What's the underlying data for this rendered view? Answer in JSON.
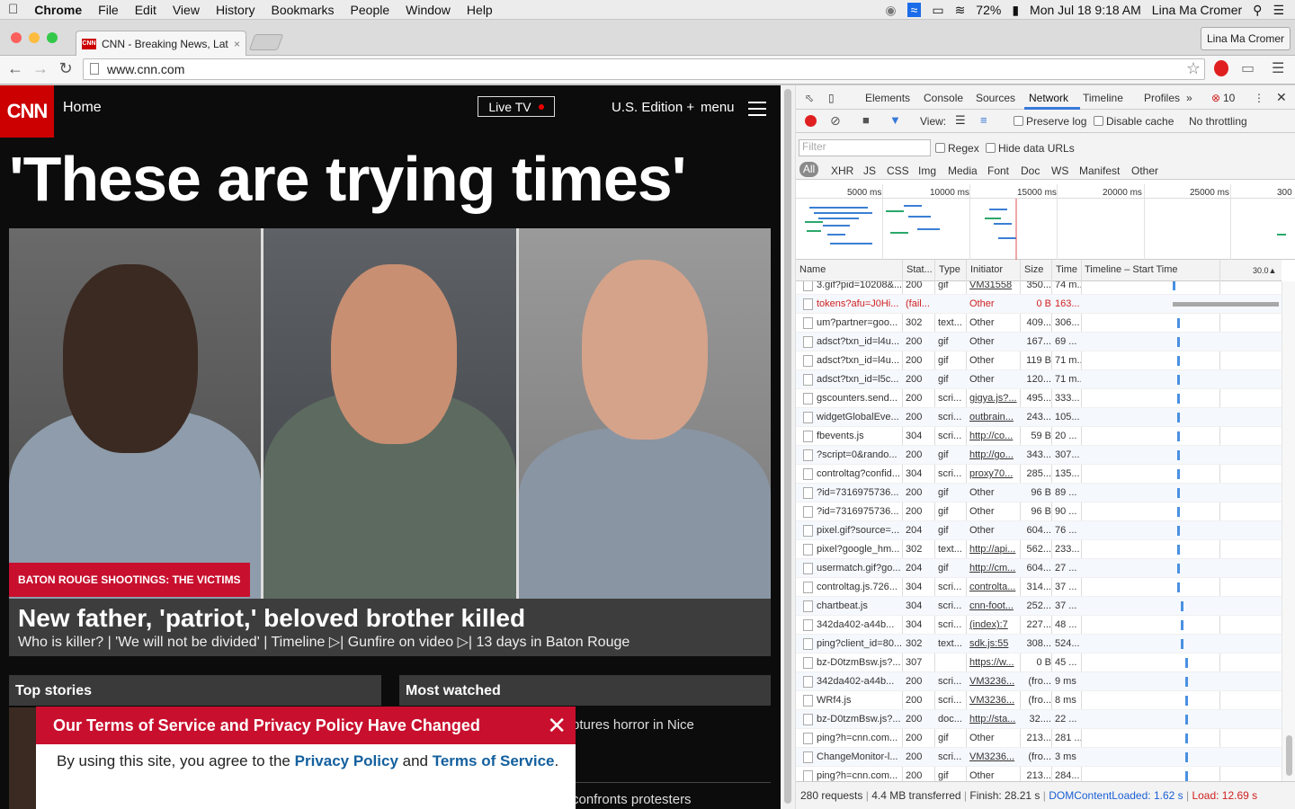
{
  "menubar": {
    "app": "Chrome",
    "items": [
      "File",
      "Edit",
      "View",
      "History",
      "Bookmarks",
      "People",
      "Window",
      "Help"
    ],
    "battery": "72%",
    "datetime": "Mon Jul 18  9:18 AM",
    "user": "Lina Ma Cromer"
  },
  "browser": {
    "tab_title": "CNN - Breaking News, Late",
    "favicon_text": "CNN",
    "profile": "Lina Ma Cromer",
    "url": "www.cnn.com"
  },
  "cnn": {
    "logo": "CNN",
    "home": "Home",
    "live_tv": "Live TV",
    "edition": "U.S. Edition +",
    "menu": "menu",
    "headline": "'These are trying times'",
    "story_tag": "BATON ROUGE SHOOTINGS: THE VICTIMS",
    "story_title": "New father, 'patriot,' beloved brother killed",
    "story_links": "Who is killer? | 'We will not be divided' | Timeline ▷| Gunfire on video ▷| 13 days in Baton Rouge",
    "top_stories": "Top stories",
    "most_watched": "Most watched",
    "mw_item1": "ptures horror in Nice",
    "mw_item2": "confronts protesters",
    "terms_title": "Our Terms of Service and Privacy Policy Have Changed",
    "terms_pre": "By using this site, you agree to the ",
    "terms_privacy": "Privacy Policy",
    "terms_and": " and ",
    "terms_tos": "Terms of Service",
    "terms_end": "."
  },
  "devtools": {
    "tabs": [
      "Elements",
      "Console",
      "Sources",
      "Network",
      "Timeline",
      "Profiles"
    ],
    "active_tab": "Network",
    "more": "»",
    "error_count": "10",
    "toolbar": {
      "view": "View:",
      "preserve_log": "Preserve log",
      "disable_cache": "Disable cache",
      "throttling": "No throttling"
    },
    "filter_placeholder": "Filter",
    "regex": "Regex",
    "hide_data_urls": "Hide data URLs",
    "types": [
      "All",
      "XHR",
      "JS",
      "CSS",
      "Img",
      "Media",
      "Font",
      "Doc",
      "WS",
      "Manifest",
      "Other"
    ],
    "overview_ticks": [
      "5000 ms",
      "10000 ms",
      "15000 ms",
      "20000 ms",
      "25000 ms",
      "300"
    ],
    "columns": [
      "Name",
      "Stat...",
      "Type",
      "Initiator",
      "Size",
      "Time",
      "Timeline – Start Time",
      "30.0▲"
    ],
    "rows": [
      {
        "name": "3.gif?pid=10208&...",
        "status": "200",
        "type": "gif",
        "init": "VM31558",
        "size": "350...",
        "time": "74 m...",
        "link": true,
        "bar": 0.0
      },
      {
        "name": "tokens?afu=J0Hi...",
        "status": "(fail...",
        "type": "",
        "init": "Other",
        "size": "0 B",
        "time": "163...",
        "fail": true,
        "bar": 0.0
      },
      {
        "name": "um?partner=goo...",
        "status": "302",
        "type": "text...",
        "init": "Other",
        "size": "409...",
        "time": "306...",
        "bar": 0.01
      },
      {
        "name": "adsct?txn_id=l4u...",
        "status": "200",
        "type": "gif",
        "init": "Other",
        "size": "167...",
        "time": "69 ...",
        "bar": 0.01
      },
      {
        "name": "adsct?txn_id=l4u...",
        "status": "200",
        "type": "gif",
        "init": "Other",
        "size": "119 B",
        "time": "71 m...",
        "bar": 0.01
      },
      {
        "name": "adsct?txn_id=l5c...",
        "status": "200",
        "type": "gif",
        "init": "Other",
        "size": "120...",
        "time": "71 m...",
        "bar": 0.01
      },
      {
        "name": "gscounters.send...",
        "status": "200",
        "type": "scri...",
        "init": "gigya.js?...",
        "size": "495...",
        "time": "333...",
        "link": true,
        "bar": 0.01
      },
      {
        "name": "widgetGlobalEve...",
        "status": "200",
        "type": "scri...",
        "init": "outbrain...",
        "size": "243...",
        "time": "105...",
        "link": true,
        "bar": 0.01
      },
      {
        "name": "fbevents.js",
        "status": "304",
        "type": "scri...",
        "init": "http://co...",
        "size": "59 B",
        "time": "20 ...",
        "link": true,
        "bar": 0.01
      },
      {
        "name": "?script=0&rando...",
        "status": "200",
        "type": "gif",
        "init": "http://go...",
        "size": "343...",
        "time": "307...",
        "link": true,
        "bar": 0.01
      },
      {
        "name": "controltag?confid...",
        "status": "304",
        "type": "scri...",
        "init": "proxy70...",
        "size": "285...",
        "time": "135...",
        "link": true,
        "bar": 0.01
      },
      {
        "name": "?id=7316975736...",
        "status": "200",
        "type": "gif",
        "init": "Other",
        "size": "96 B",
        "time": "89 ...",
        "bar": 0.01
      },
      {
        "name": "?id=7316975736...",
        "status": "200",
        "type": "gif",
        "init": "Other",
        "size": "96 B",
        "time": "90 ...",
        "bar": 0.01
      },
      {
        "name": "pixel.gif?source=...",
        "status": "204",
        "type": "gif",
        "init": "Other",
        "size": "604...",
        "time": "76 ...",
        "bar": 0.01
      },
      {
        "name": "pixel?google_hm...",
        "status": "302",
        "type": "text...",
        "init": "http://api...",
        "size": "562...",
        "time": "233...",
        "link": true,
        "bar": 0.01
      },
      {
        "name": "usermatch.gif?go...",
        "status": "204",
        "type": "gif",
        "init": "http://cm...",
        "size": "604...",
        "time": "27 ...",
        "link": true,
        "bar": 0.01
      },
      {
        "name": "controltag.js.726...",
        "status": "304",
        "type": "scri...",
        "init": "controlta...",
        "size": "314...",
        "time": "37 ...",
        "link": true,
        "bar": 0.01
      },
      {
        "name": "chartbeat.js",
        "status": "304",
        "type": "scri...",
        "init": "cnn-foot...",
        "size": "252...",
        "time": "37 ...",
        "link": true,
        "bar": 0.02
      },
      {
        "name": "342da402-a44b...",
        "status": "304",
        "type": "scri...",
        "init": "(index):7",
        "size": "227...",
        "time": "48 ...",
        "link": true,
        "bar": 0.02
      },
      {
        "name": "ping?client_id=80...",
        "status": "302",
        "type": "text...",
        "init": "sdk.js:55",
        "size": "308...",
        "time": "524...",
        "link": true,
        "bar": 0.02
      },
      {
        "name": "bz-D0tzmBsw.js?...",
        "status": "307",
        "type": "",
        "init": "https://w...",
        "size": "0 B",
        "time": "45 ...",
        "link": true,
        "bar": 0.03
      },
      {
        "name": "342da402-a44b...",
        "status": "200",
        "type": "scri...",
        "init": "VM3236...",
        "size": "(fro...",
        "time": "9 ms",
        "link": true,
        "bar": 0.03
      },
      {
        "name": "WRf4.js",
        "status": "200",
        "type": "scri...",
        "init": "VM3236...",
        "size": "(fro...",
        "time": "8 ms",
        "link": true,
        "bar": 0.03
      },
      {
        "name": "bz-D0tzmBsw.js?...",
        "status": "200",
        "type": "doc...",
        "init": "http://sta...",
        "size": "32....",
        "time": "22 ...",
        "link": true,
        "bar": 0.03
      },
      {
        "name": "ping?h=cnn.com...",
        "status": "200",
        "type": "gif",
        "init": "Other",
        "size": "213...",
        "time": "281 ...",
        "bar": 0.03
      },
      {
        "name": "ChangeMonitor-l...",
        "status": "200",
        "type": "scri...",
        "init": "VM3236...",
        "size": "(fro...",
        "time": "3 ms",
        "link": true,
        "bar": 0.03
      },
      {
        "name": "ping?h=cnn.com...",
        "status": "200",
        "type": "gif",
        "init": "Other",
        "size": "213...",
        "time": "284...",
        "bar": 0.03
      }
    ],
    "status": {
      "requests": "280 requests",
      "transferred": "4.4 MB transferred",
      "finish": "Finish: 28.21 s",
      "dcl": "DOMContentLoaded: 1.62 s",
      "load": "Load: 12.69 s"
    }
  },
  "colors": {
    "cnn_red": "#cc0000",
    "dcl_blue": "#1a5fd6",
    "load_red": "#d02020",
    "link_blue": "#14609e"
  }
}
